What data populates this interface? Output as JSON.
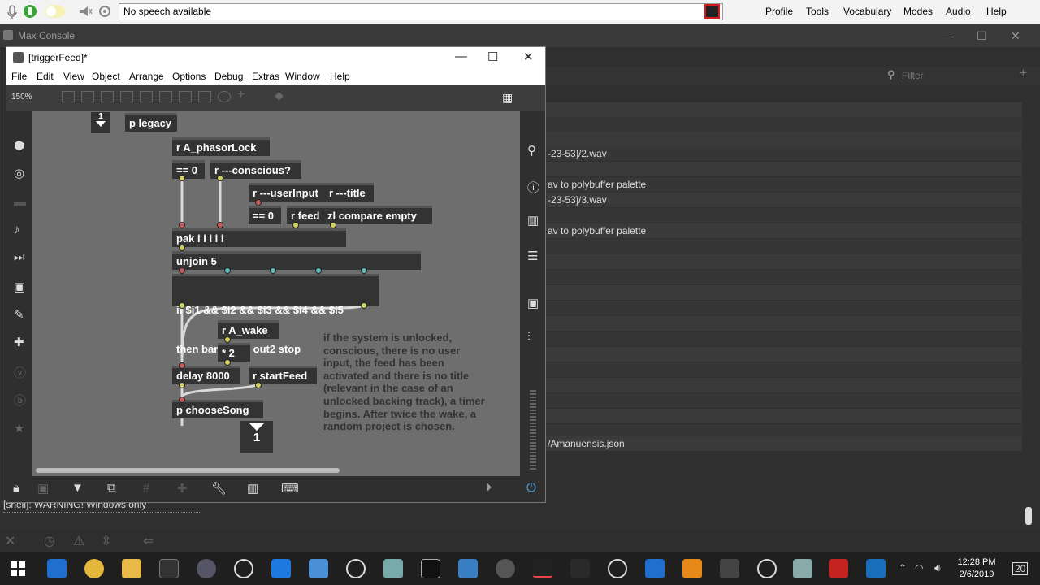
{
  "speechbar": {
    "status": "No speech available",
    "menus": [
      "Profile",
      "Tools",
      "Vocabulary",
      "Modes",
      "Audio",
      "Help"
    ]
  },
  "console": {
    "title": "Max Console",
    "filter_placeholder": "Filter",
    "lines": [
      "-23-53]/2.wav",
      "av to polybuffer palette",
      "-23-53]/3.wav",
      "av to polybuffer palette",
      "/Amanuensis.json"
    ],
    "warning": "[shell]: WARNING! Windows only"
  },
  "patcher": {
    "title": "[triggerFeed]*",
    "menus": [
      "File",
      "Edit",
      "View",
      "Object",
      "Arrange",
      "Options",
      "Debug",
      "Extras",
      "Window",
      "Help"
    ],
    "zoom": "150%",
    "inlet_number": "1",
    "outlet_number": "1",
    "objects": {
      "legacy": "p legacy",
      "phasor": "r A_phasorLock",
      "eq0a": "== 0",
      "conscious": "r ---conscious?",
      "userinput": "r ---userInput",
      "title": "r ---title",
      "eq0b": "== 0",
      "feed": "r feed",
      "zl": "zl compare empty",
      "pak": "pak i i i i i",
      "unjoin": "unjoin 5",
      "if1": "if $i1 && $i2 && $i3 && $i4 && $i5",
      "if2": "then bang else out2 stop",
      "wake": "r A_wake",
      "mul": "* 2",
      "delay": "delay 8000",
      "startfeed": "r startFeed",
      "choosesong": "p chooseSong"
    },
    "comment": "if the system is unlocked, conscious, there is no user input, the feed has been activated and there is no title (relevant in the case of an unlocked backing track), a timer begins. After twice the wake, a random project is chosen."
  },
  "taskbar": {
    "time": "12:28 PM",
    "date": "2/6/2019",
    "notifications": "20"
  },
  "colors": {
    "canvas": "#6e6e6e",
    "object": "#333333",
    "msg_port": "#d4d060",
    "sig_port": "#5fb8b8",
    "bang_port": "#c85a5a"
  }
}
